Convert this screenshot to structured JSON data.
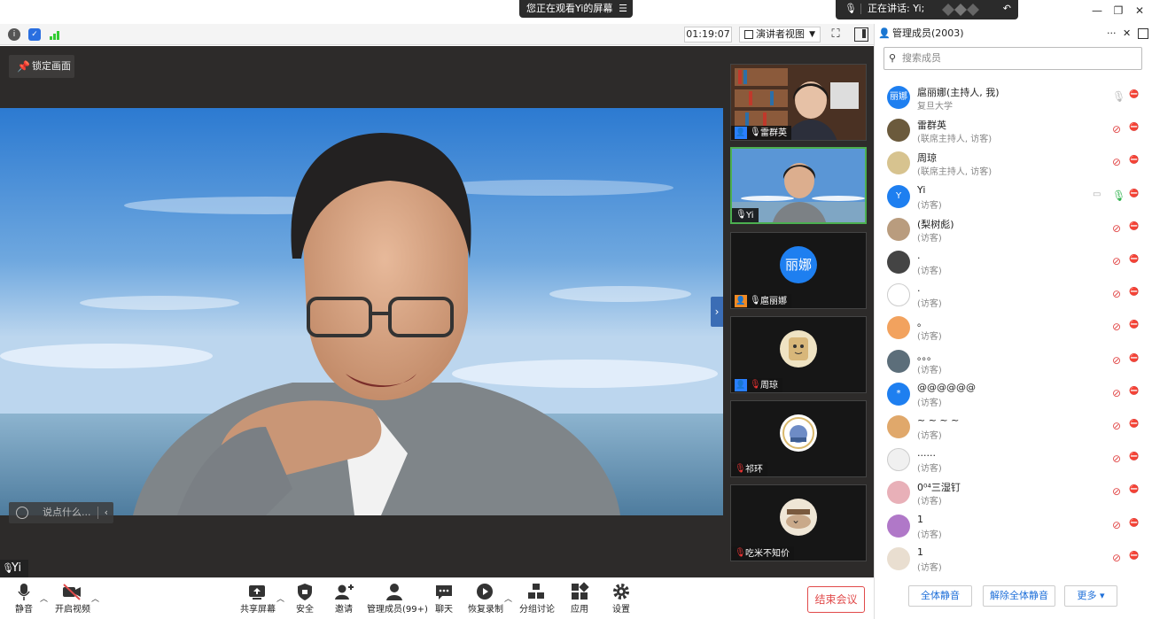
{
  "titlebar": {
    "viewing_text": "您正在观看Yi的屏幕",
    "talking_text": "正在讲话: Yi;",
    "window_controls": [
      "minimize",
      "restore",
      "close"
    ]
  },
  "toolbar_top": {
    "timer": "01:19:07",
    "view_mode": "演讲者视图",
    "icons": [
      "info-icon",
      "shield-icon",
      "signal-icon",
      "fullscreen-icon",
      "panel-toggle-icon"
    ]
  },
  "main_video": {
    "lock_label": "锁定画面",
    "chat_placeholder": "说点什么...",
    "speaker_name": "Yi"
  },
  "thumbnails": [
    {
      "name": "雷群英",
      "host_badge": true,
      "badge_color": "#2a7fff",
      "mic": "on",
      "type": "video"
    },
    {
      "name": "Yi",
      "host_badge": false,
      "mic": "on",
      "type": "video",
      "active": true
    },
    {
      "name": "扈丽娜",
      "host_badge": true,
      "badge_color": "#f08a24",
      "mic": "on",
      "type": "avatar",
      "avatar_text": "丽娜"
    },
    {
      "name": "周琼",
      "host_badge": true,
      "badge_color": "#2a7fff",
      "mic": "muted",
      "type": "image"
    },
    {
      "name": "祁环",
      "host_badge": false,
      "mic": "muted",
      "type": "image"
    },
    {
      "name": "吃米不知价",
      "host_badge": false,
      "mic": "muted",
      "type": "image"
    }
  ],
  "bottom_toolbar": {
    "mute": "静音",
    "video": "开启视频",
    "share": "共享屏幕",
    "security": "安全",
    "invite": "邀请",
    "participants": "管理成员(99+)",
    "chat": "聊天",
    "recording": "恢复录制",
    "breakout": "分组讨论",
    "apps": "应用",
    "settings": "设置",
    "end": "结束会议"
  },
  "participants_panel": {
    "title": "管理成员(2003)",
    "search_placeholder": "搜索成员",
    "members": [
      {
        "line1": "扈丽娜(主持人, 我)",
        "line2": "复旦大学",
        "avatar_text": "丽娜",
        "avatar_color": "#1e7ff0",
        "mic": "gray",
        "cam": "off"
      },
      {
        "line1": "雷群英",
        "line2": "(联席主持人, 访客)",
        "avatar_text": "",
        "avatar_color": "#6b5a3c",
        "mic": "muted",
        "cam": "off"
      },
      {
        "line1": "周琼",
        "line2": "(联席主持人, 访客)",
        "avatar_text": "",
        "avatar_color": "#d7c38f",
        "mic": "muted",
        "cam": "off"
      },
      {
        "line1": "Yi",
        "line2": "(访客)",
        "avatar_text": "Y",
        "avatar_color": "#1e7ff0",
        "mic": "on",
        "cam": "off",
        "share": true
      },
      {
        "line1": "(梨树彪)",
        "line2": "(访客)",
        "avatar_text": "",
        "avatar_color": "#b99c7e",
        "mic": "muted",
        "cam": "off"
      },
      {
        "line1": ".",
        "line2": "(访客)",
        "avatar_text": "",
        "avatar_color": "#444444",
        "mic": "muted",
        "cam": "off"
      },
      {
        "line1": ".",
        "line2": "(访客)",
        "avatar_text": "",
        "avatar_color": "#ffffff",
        "mic": "muted",
        "cam": "off"
      },
      {
        "line1": "。",
        "line2": "(访客)",
        "avatar_text": "",
        "avatar_color": "#f2a25e",
        "mic": "muted",
        "cam": "off"
      },
      {
        "line1": "。。。",
        "line2": "(访客)",
        "avatar_text": "",
        "avatar_color": "#5c6e7a",
        "mic": "muted",
        "cam": "off"
      },
      {
        "line1": "@@@@@@",
        "line2": "(访客)",
        "avatar_text": "*",
        "avatar_color": "#1e7ff0",
        "mic": "muted",
        "cam": "off"
      },
      {
        "line1": "~ ~ ~ ~",
        "line2": "(访客)",
        "avatar_text": "",
        "avatar_color": "#e0a86b",
        "mic": "muted",
        "cam": "off"
      },
      {
        "line1": "......",
        "line2": "(访客)",
        "avatar_text": "",
        "avatar_color": "#f0f0f0",
        "mic": "muted",
        "cam": "off"
      },
      {
        "line1": "0⁰⁴三湿钉",
        "line2": "(访客)",
        "avatar_text": "",
        "avatar_color": "#e8b0b8",
        "mic": "muted",
        "cam": "off"
      },
      {
        "line1": "1",
        "line2": "(访客)",
        "avatar_text": "",
        "avatar_color": "#b078c8",
        "mic": "muted",
        "cam": "off"
      },
      {
        "line1": "1",
        "line2": "(访客)",
        "avatar_text": "",
        "avatar_color": "#e9ded0",
        "mic": "muted",
        "cam": "off"
      }
    ],
    "mute_all": "全体静音",
    "unmute_all": "解除全体静音",
    "more": "更多"
  }
}
